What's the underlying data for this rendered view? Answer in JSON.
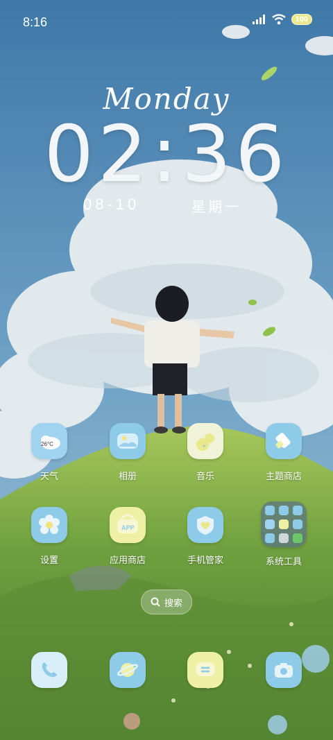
{
  "status_bar": {
    "time": "8:16",
    "battery": "100"
  },
  "clock": {
    "day_label": "Monday",
    "time": "02:36",
    "date": "08-10",
    "weekday": "星期一"
  },
  "apps": [
    {
      "label": "天气",
      "icon": "weather-icon",
      "temp": "26°C"
    },
    {
      "label": "相册",
      "icon": "gallery-icon"
    },
    {
      "label": "音乐",
      "icon": "music-icon"
    },
    {
      "label": "主题商店",
      "icon": "theme-store-icon"
    },
    {
      "label": "设置",
      "icon": "settings-icon"
    },
    {
      "label": "应用商店",
      "icon": "app-store-icon",
      "badge": "APP"
    },
    {
      "label": "手机管家",
      "icon": "phone-manager-icon"
    },
    {
      "label": "系统工具",
      "icon": "system-tools-folder-icon"
    }
  ],
  "search": {
    "label": "搜索"
  },
  "dock": [
    {
      "icon": "phone-icon"
    },
    {
      "icon": "browser-icon"
    },
    {
      "icon": "messages-icon"
    },
    {
      "icon": "camera-icon"
    }
  ],
  "colors": {
    "sky": "#4f88b6",
    "grass": "#6ca043",
    "icon_blue": "#8ecbe8",
    "icon_yellow": "#eef0a6"
  }
}
